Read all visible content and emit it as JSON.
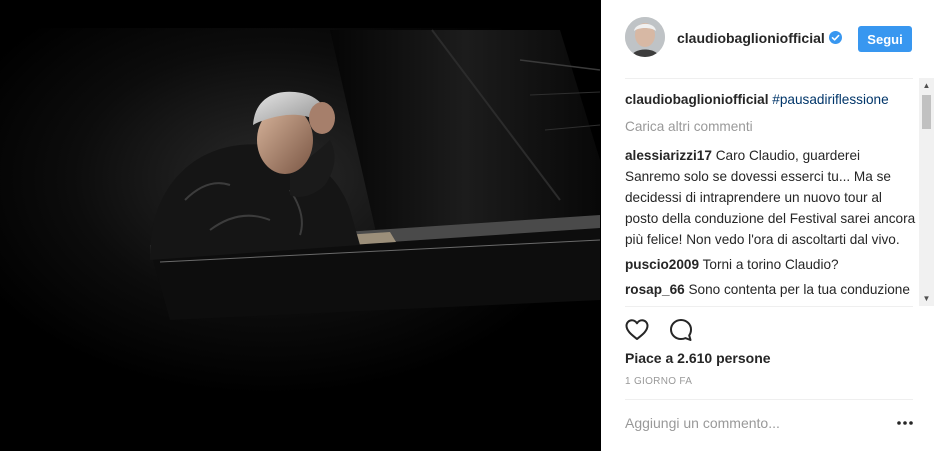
{
  "post": {
    "username": "claudiobaglioniofficial",
    "follow_label": "Segui",
    "caption_user": "claudiobaglioniofficial",
    "caption_hashtag": "#pausadiriflessione",
    "load_more": "Carica altri commenti",
    "likes": "Piace a 2.610 persone",
    "timestamp": "1 GIORNO FA",
    "add_comment_placeholder": "Aggiungi un commento..."
  },
  "comments": [
    {
      "user": "alessiarizzi17",
      "text": "Caro Claudio, guarderei Sanremo solo se dovessi esserci tu... Ma se decidessi di intraprendere un nuovo tour al posto della conduzione del Festival sarei ancora più felice! Non vedo l'ora di ascoltarti dal vivo."
    },
    {
      "user": "puscio2009",
      "text": "Torni a torino Claudio?"
    },
    {
      "user": "rosap_66",
      "text": "Sono contenta per la tua conduzione del festival sei un grande"
    }
  ],
  "icons": {
    "verified": "verified-badge-icon",
    "like": "heart-icon",
    "comment": "comment-bubble-icon",
    "more": "more-options-icon"
  },
  "colors": {
    "accent": "#3897f0",
    "hashtag": "#003569",
    "muted": "#999999",
    "photo_bg": "#000000"
  }
}
